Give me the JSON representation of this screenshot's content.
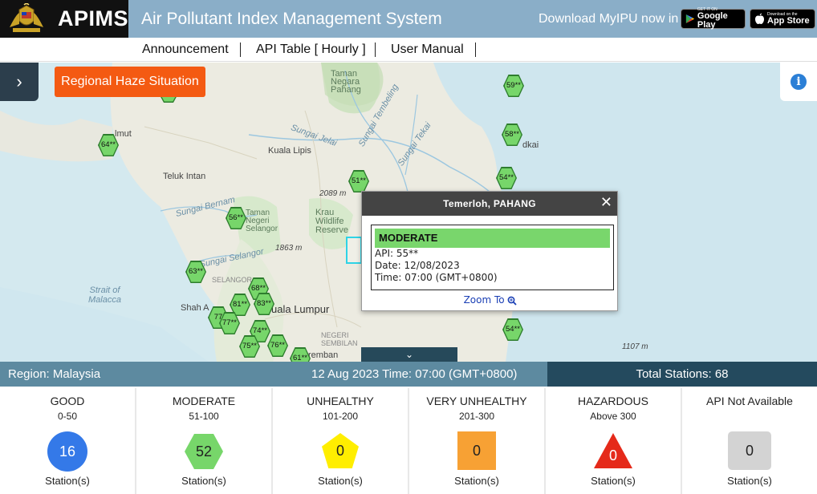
{
  "header": {
    "brand": "APIMS",
    "title": "Air Pollutant Index Management System",
    "download_text": "Download MyIPU now in",
    "google_play": {
      "small": "GET IT ON",
      "big": "Google Play"
    },
    "app_store": {
      "small": "Download on the",
      "big": "App Store"
    }
  },
  "nav": {
    "items": [
      "Announcement",
      "API Table [ Hourly ]",
      "User Manual"
    ]
  },
  "map": {
    "haze_button": "Regional Haze Situation",
    "expand_icon": "chevron-right-icon",
    "info_icon": "info-icon",
    "labels": {
      "taman_negara": "Taman\nNegara\nPahang",
      "kuala_lipis": "Kuala Lipis",
      "teluk_intan": "Teluk Intan",
      "sungai_jelai": "Sungai Jelai",
      "sungai_tembeling": "Sungai Tembeling",
      "sungai_tekai": "Sungai Tekai",
      "sungai_bernam": "Sungai Bernam",
      "sungai_selangor": "Sungai Selangor",
      "strait": "Strait of\nMalacca",
      "krau": "Krau\nWildlife\nReserve",
      "elev_2089": "2089 m",
      "elev_1863": "1863 m",
      "elev_1107": "1107 m",
      "selangor": "SELANGOR",
      "negeri": "NEGERI\nSEMBILAN",
      "kuala_lumpur": "uala Lumpur",
      "shah_alam": "Shah A",
      "taman_selangor": "Taman\nNegeri\nSelangor",
      "lmut": "lmut",
      "dkai": "dkai",
      "remban": "remban"
    },
    "stations": [
      {
        "id": "s59",
        "label": "59**"
      },
      {
        "id": "s64",
        "label": "64**"
      },
      {
        "id": "s58",
        "label": "58**"
      },
      {
        "id": "s51",
        "label": "51**"
      },
      {
        "id": "s54a",
        "label": "54**"
      },
      {
        "id": "s56",
        "label": "56**"
      },
      {
        "id": "s63",
        "label": "63**"
      },
      {
        "id": "s68",
        "label": "68**"
      },
      {
        "id": "s81",
        "label": "81**"
      },
      {
        "id": "s83",
        "label": "83**"
      },
      {
        "id": "s77a",
        "label": "77"
      },
      {
        "id": "s77b",
        "label": "77**"
      },
      {
        "id": "s74",
        "label": "74**"
      },
      {
        "id": "s75",
        "label": "75**"
      },
      {
        "id": "s76",
        "label": "76**"
      },
      {
        "id": "s61",
        "label": "61**"
      },
      {
        "id": "s54b",
        "label": "54**"
      }
    ],
    "popup": {
      "title": "Temerloh, PAHANG",
      "status": "MODERATE",
      "api": "API: 55**",
      "date": "Date: 12/08/2023",
      "time": "Time: 07:00 (GMT+0800)",
      "zoom": "Zoom To"
    }
  },
  "status_bar": {
    "region": "Region: Malaysia",
    "datetime": "12 Aug 2023   Time: 07:00 (GMT+0800)",
    "total": "Total Stations: 68"
  },
  "legend": [
    {
      "name": "GOOD",
      "range": "0-50",
      "count": "16",
      "stations": "Station(s)",
      "color": "#3479e8"
    },
    {
      "name": "MODERATE",
      "range": "51-100",
      "count": "52",
      "stations": "Station(s)",
      "color": "#77d66a"
    },
    {
      "name": "UNHEALTHY",
      "range": "101-200",
      "count": "0",
      "stations": "Station(s)",
      "color": "#ffee00"
    },
    {
      "name": "VERY UNHEALTHY",
      "range": "201-300",
      "count": "0",
      "stations": "Station(s)",
      "color": "#f7a134"
    },
    {
      "name": "HAZARDOUS",
      "range": "Above 300",
      "count": "0",
      "stations": "Station(s)",
      "color": "#e52a1a"
    },
    {
      "name": "API Not Available",
      "range": "",
      "count": "0",
      "stations": "Station(s)",
      "color": "#d3d3d3"
    }
  ]
}
